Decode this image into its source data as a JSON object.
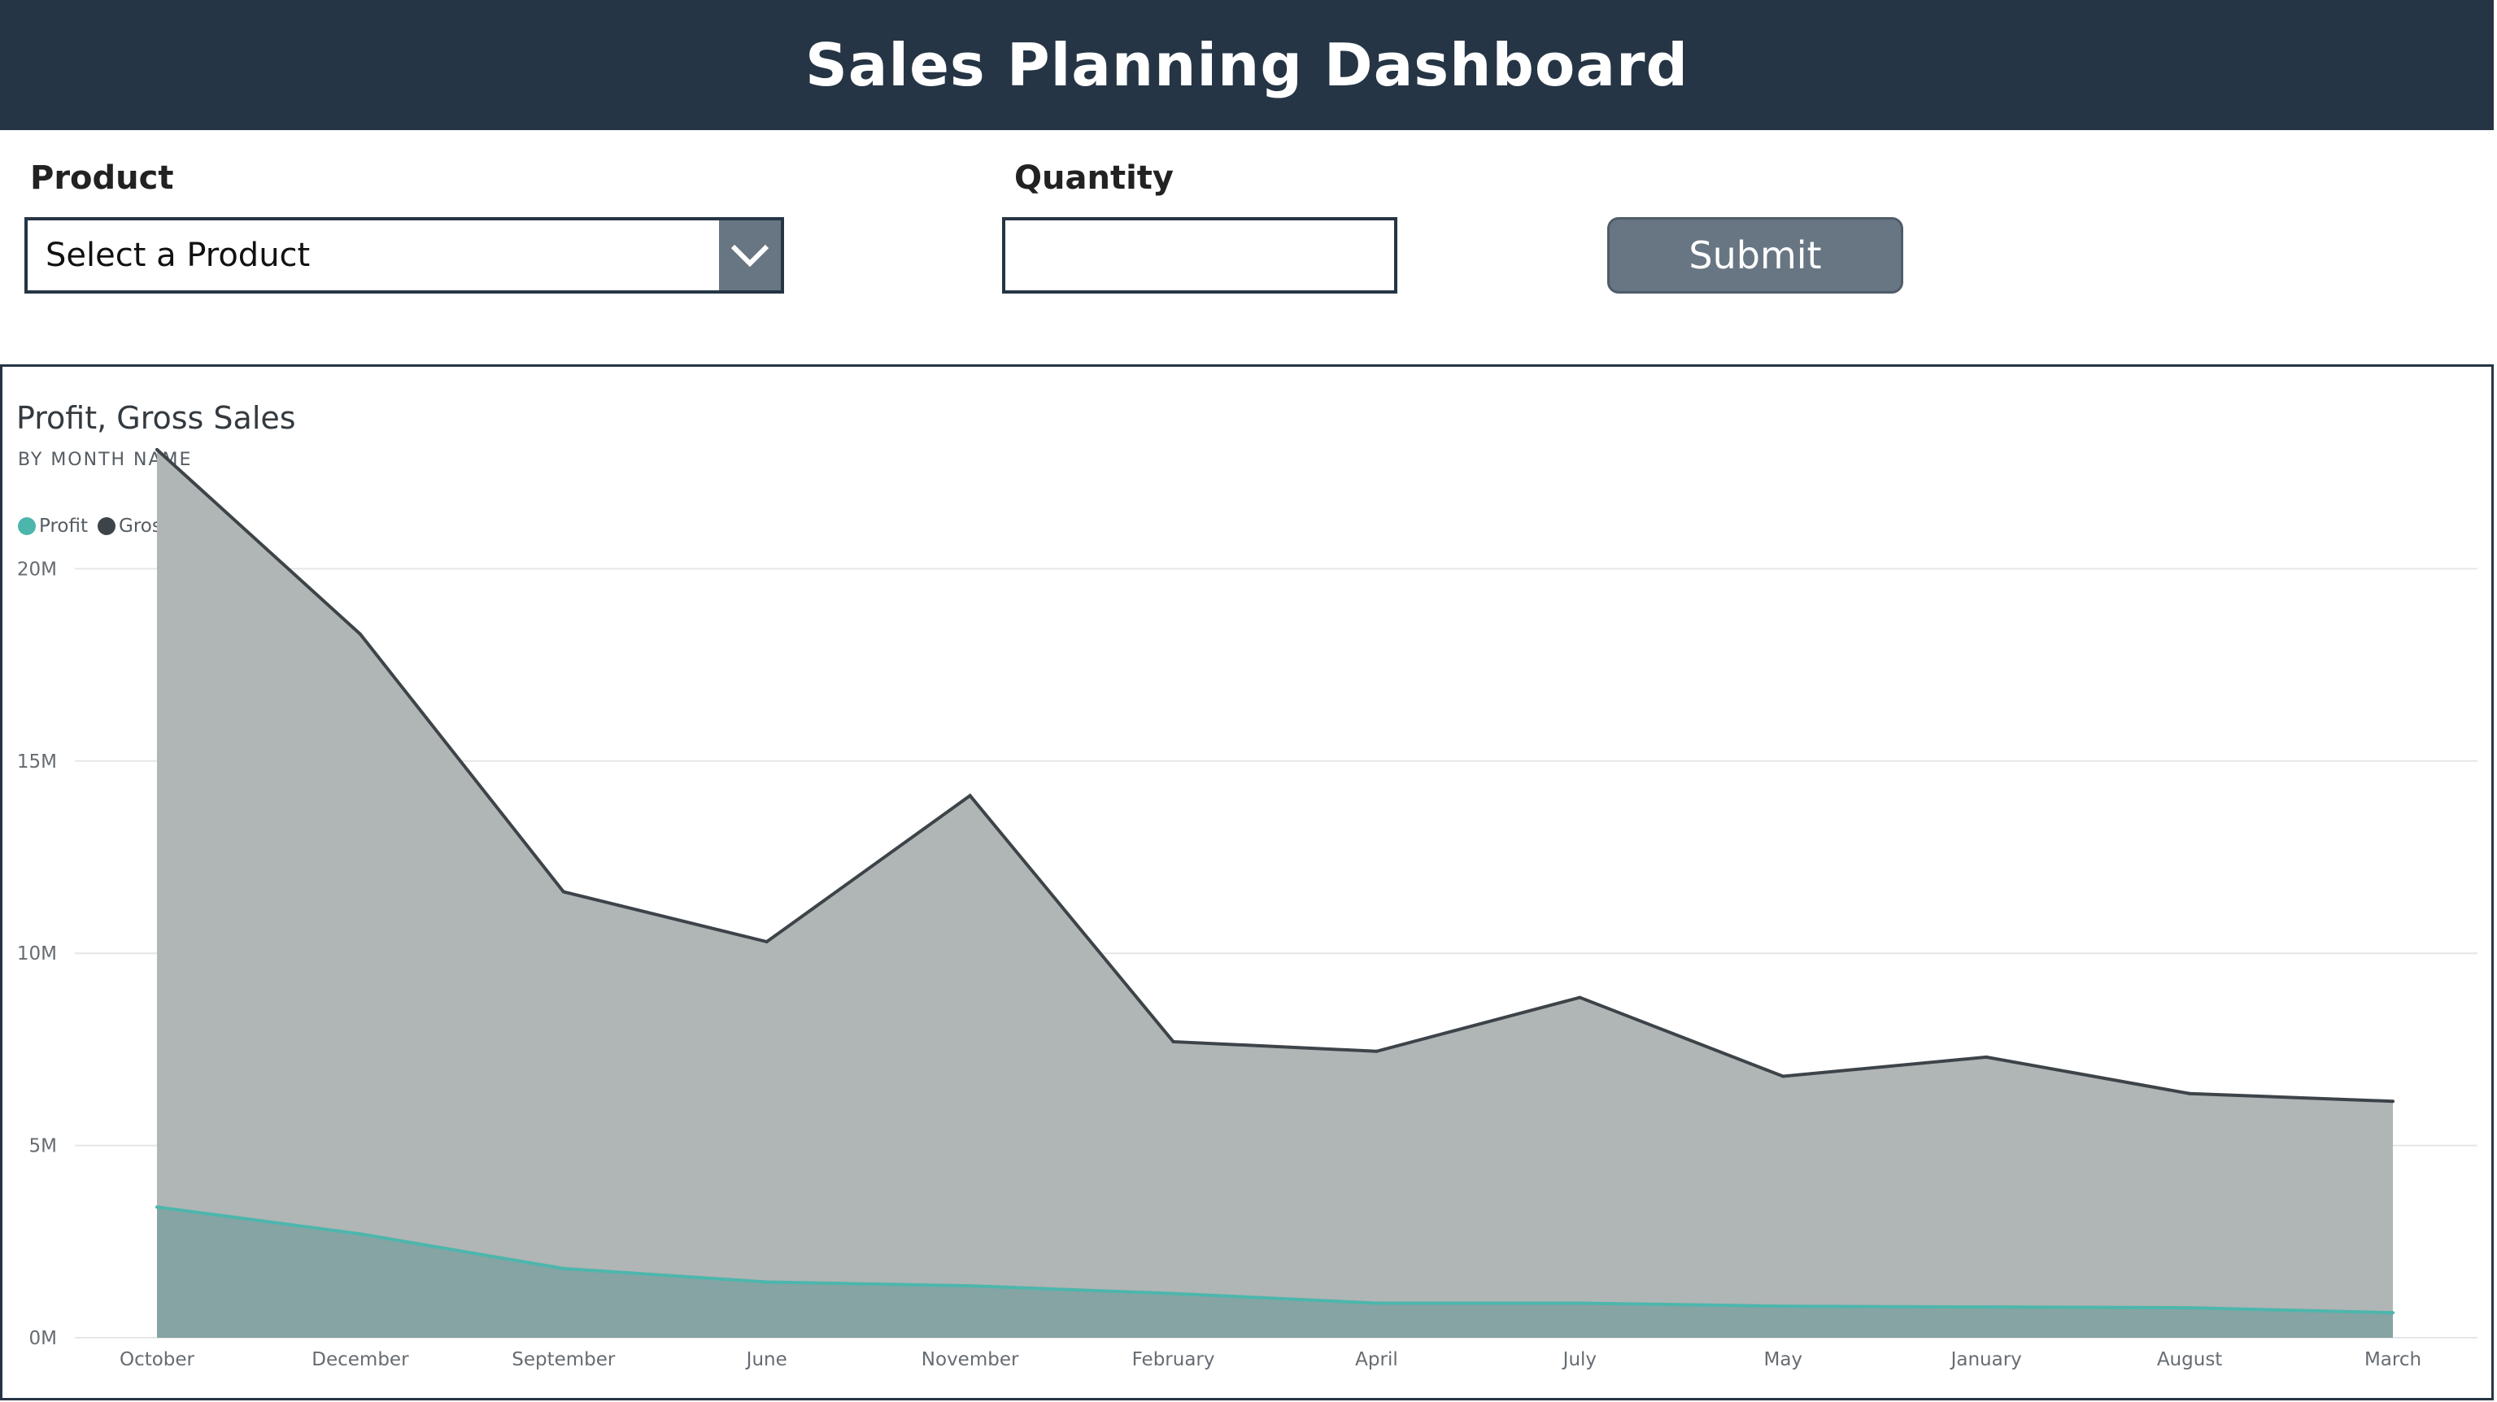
{
  "header": {
    "title": "Sales Planning Dashboard"
  },
  "form": {
    "product_label": "Product",
    "product_select_value": "Select a Product",
    "quantity_label": "Quantity",
    "quantity_value": "",
    "submit_label": "Submit"
  },
  "colors": {
    "header_bg": "#253545",
    "button_bg": "#687683",
    "profit": "#4db6ac",
    "gross_sales": "#3d4449",
    "gross_sales_fill": "#b0b5b5",
    "profit_fill": "#86a4a3"
  },
  "chart_data": {
    "type": "area",
    "title": "Profit, Gross Sales",
    "subtitle": "BY MONTH NAME",
    "legend_position": "top-left",
    "grid": true,
    "categories": [
      "October",
      "December",
      "September",
      "June",
      "November",
      "February",
      "April",
      "July",
      "May",
      "January",
      "August",
      "March"
    ],
    "series": [
      {
        "name": "Profit",
        "color": "#4db6ac",
        "values": [
          3.4,
          2.7,
          1.8,
          1.45,
          1.35,
          1.15,
          0.9,
          0.9,
          0.82,
          0.8,
          0.78,
          0.65
        ]
      },
      {
        "name": "Gross Sales",
        "color": "#3d4449",
        "values": [
          23.1,
          18.3,
          11.6,
          10.3,
          14.1,
          7.7,
          7.45,
          8.85,
          6.8,
          7.3,
          6.35,
          6.15
        ]
      }
    ],
    "yticks": [
      "0M",
      "5M",
      "10M",
      "15M",
      "20M"
    ],
    "ylim": [
      0,
      25
    ]
  }
}
